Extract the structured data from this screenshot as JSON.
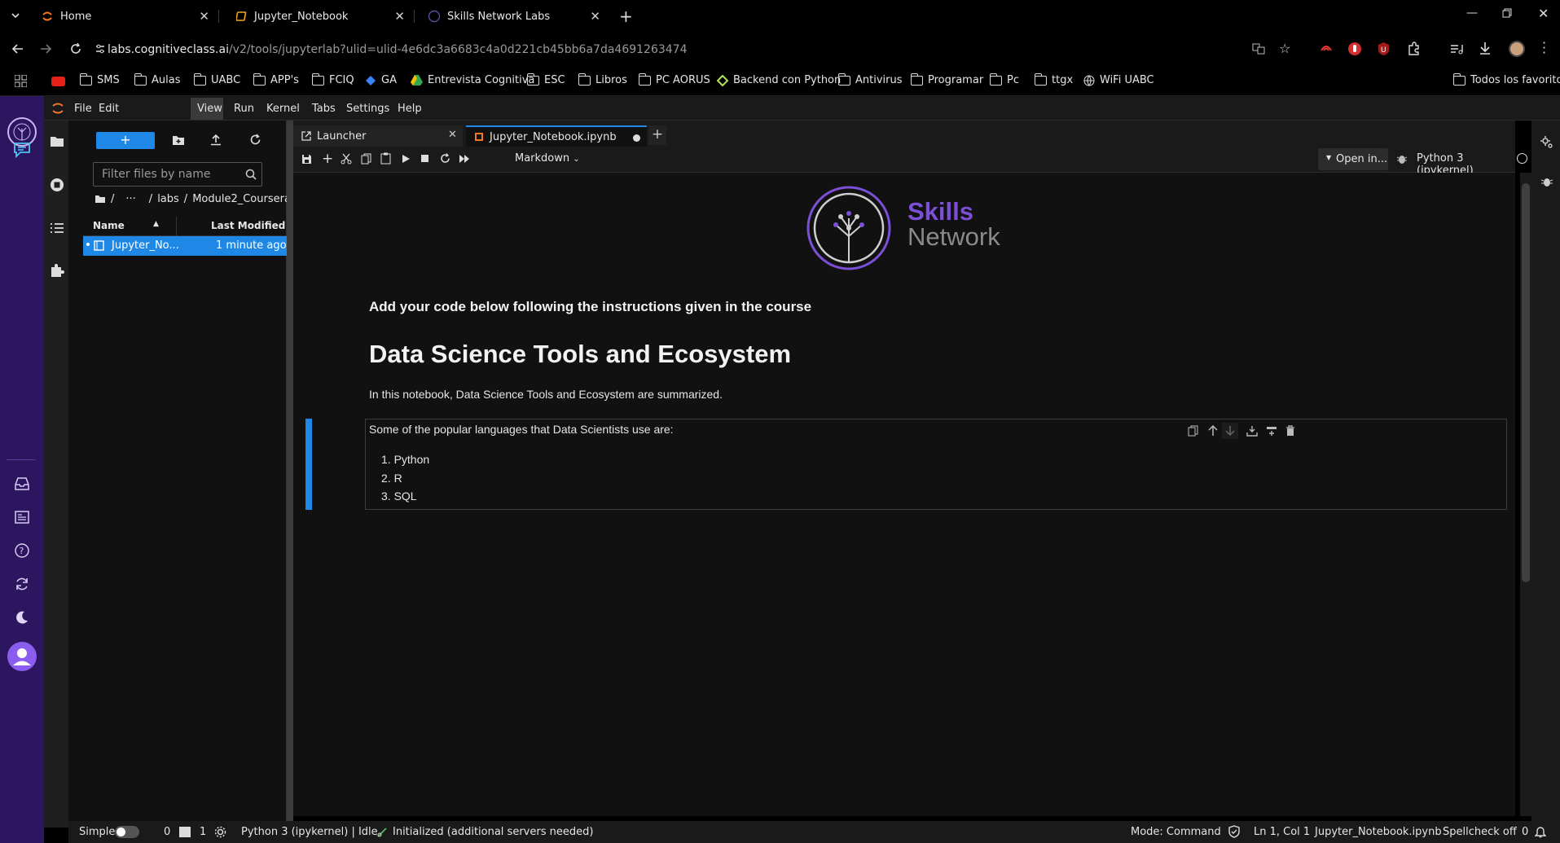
{
  "browser": {
    "tabs": [
      {
        "title": "Home"
      },
      {
        "title": "Jupyter_Notebook"
      },
      {
        "title": "Skills Network Labs"
      }
    ],
    "url_host": "labs.cognitiveclass.ai",
    "url_path": "/v2/tools/jupyterlab?ulid=ulid-4e6dc3a6683c4a0d221cb45bb6a7da4691263474",
    "bookmarks": [
      "SMS",
      "Aulas",
      "UABC",
      "APP's",
      "FCIQ",
      "GA",
      "Entrevista Cognitiva",
      "ESC",
      "Libros",
      "PC AORUS",
      "Backend con Python",
      "Antivirus",
      "Programar",
      "Pc",
      "ttgx",
      "WiFi UABC"
    ],
    "all_bookmarks": "Todos los favoritos"
  },
  "jupyter": {
    "menu": [
      "File",
      "Edit",
      "View",
      "Run",
      "Kernel",
      "Tabs",
      "Settings",
      "Help"
    ],
    "filebrowser": {
      "filter_placeholder": "Filter files by name",
      "breadcrumb": {
        "root": "/",
        "ellipsis": "···",
        "labs": "labs",
        "module": "Module2_Coursera",
        "trail": "/"
      },
      "col_name": "Name",
      "col_modified": "Last Modified",
      "file_name": "Jupyter_No...",
      "file_modified": "1 minute ago"
    },
    "doctabs": [
      {
        "label": "Launcher"
      },
      {
        "label": "Jupyter_Notebook.ipynb"
      }
    ],
    "toolbar": {
      "cell_type": "Markdown",
      "open_in": "Open in...",
      "kernel": "Python 3 (ipykernel)"
    },
    "notebook": {
      "logo_line1": "Skills",
      "logo_line2": "Network",
      "instruction": "Add your code below following the instructions given in the course",
      "heading": "Data Science Tools and Ecosystem",
      "intro": "In this notebook, Data Science Tools and Ecosystem are summarized.",
      "languages_intro": "Some of the popular languages that Data Scientists use are:",
      "languages": [
        "Python",
        "R",
        "SQL"
      ]
    },
    "status": {
      "simple": "Simple",
      "count_a": "0",
      "count_b": "1",
      "kernel_state": "Python 3 (ipykernel) | Idle",
      "lsp": "Initialized (additional servers needed)",
      "mode": "Mode: Command",
      "position": "Ln 1, Col 1",
      "file": "Jupyter_Notebook.ipynb",
      "spellcheck": "Spellcheck off",
      "notifications": "0"
    }
  },
  "colors": {
    "accent": "#1f87e5",
    "rail": "#2d1660",
    "logo_purple": "#7b4fd6",
    "logo_gray": "#8a8a8a"
  }
}
